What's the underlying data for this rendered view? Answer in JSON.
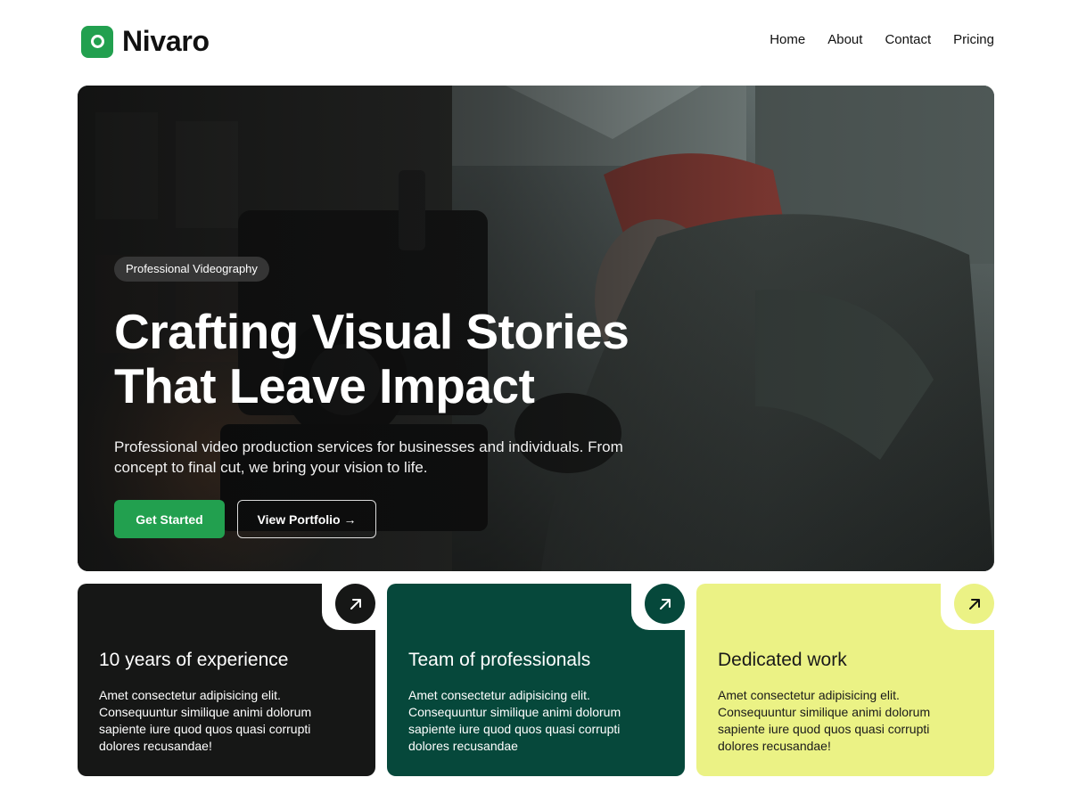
{
  "brand": {
    "name": "Nivaro",
    "accent": "#22a04f"
  },
  "nav": {
    "items": [
      {
        "label": "Home"
      },
      {
        "label": "About"
      },
      {
        "label": "Contact"
      },
      {
        "label": "Pricing"
      }
    ]
  },
  "hero": {
    "tag": "Professional Videography",
    "headline_line1": "Crafting Visual Stories",
    "headline_line2": "That Leave Impact",
    "subtext": "Professional video production services for businesses and individuals. From concept to final cut, we bring your vision to life.",
    "primary_button": "Get Started",
    "secondary_button": "View Portfolio →",
    "image": "videographer-with-cinema-camera-photo"
  },
  "cards": [
    {
      "title": "10 years of experience",
      "text": "Amet consectetur adipisicing elit. Consequuntur similique animi dolorum sapiente iure quod quos quasi corrupti dolores recusandae!",
      "color": "#161716",
      "icon": "arrow-up-right-icon"
    },
    {
      "title": "Team of professionals",
      "text": "Amet consectetur adipisicing elit. Consequuntur similique animi dolorum sapiente iure quod quos quasi corrupti dolores recusandae",
      "color": "#06483b",
      "icon": "arrow-up-right-icon"
    },
    {
      "title": "Dedicated work",
      "text": "Amet consectetur adipisicing elit. Consequuntur similique animi dolorum sapiente iure quod quos quasi corrupti dolores recusandae!",
      "color": "#ebf285",
      "icon": "arrow-up-right-icon"
    }
  ]
}
